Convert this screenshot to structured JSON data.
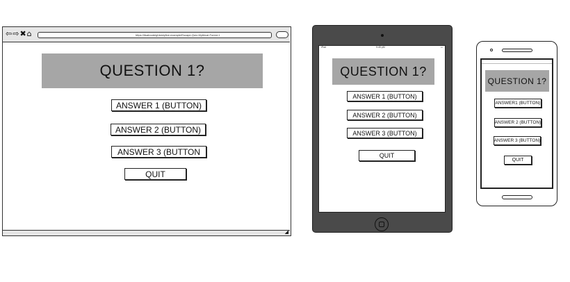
{
  "desktop": {
    "url": "https://itsabouteightsixtyfive.example/Escape-Quiz-Mythical-Forest-1",
    "question": "QUESTION 1?",
    "answers": [
      "ANSWER 1 (BUTTON)",
      "ANSWER 2 (BUTTON)",
      "ANSWER 3 (BUTTON"
    ],
    "quit": "QUIT"
  },
  "tablet": {
    "status_left": "iPad",
    "status_center": "9:45 pM",
    "question": "QUESTION 1?",
    "answers": [
      "ANSWER 1 (BUTTON)",
      "ANSWER 2 (BUTTON)",
      "ANSWER 3 (BUTTON)"
    ],
    "quit": "QUIT"
  },
  "phone": {
    "question": "QUESTION 1?",
    "answers": [
      "ANSWER1 (BUTTON)",
      "ANSWER 2 (BUTTON)",
      "ANSWER 3 (BUTTON)"
    ],
    "quit": "QUIT"
  },
  "colors": {
    "question_box": "#a6a6a6",
    "device_frame": "#4a4a4a",
    "browser_chrome": "#e6e6e6"
  },
  "icons": [
    "back-arrow-icon",
    "forward-arrow-icon",
    "close-icon",
    "home-icon",
    "search-icon",
    "resize-grip-icon",
    "camera-icon",
    "home-button-icon",
    "speaker-icon"
  ]
}
